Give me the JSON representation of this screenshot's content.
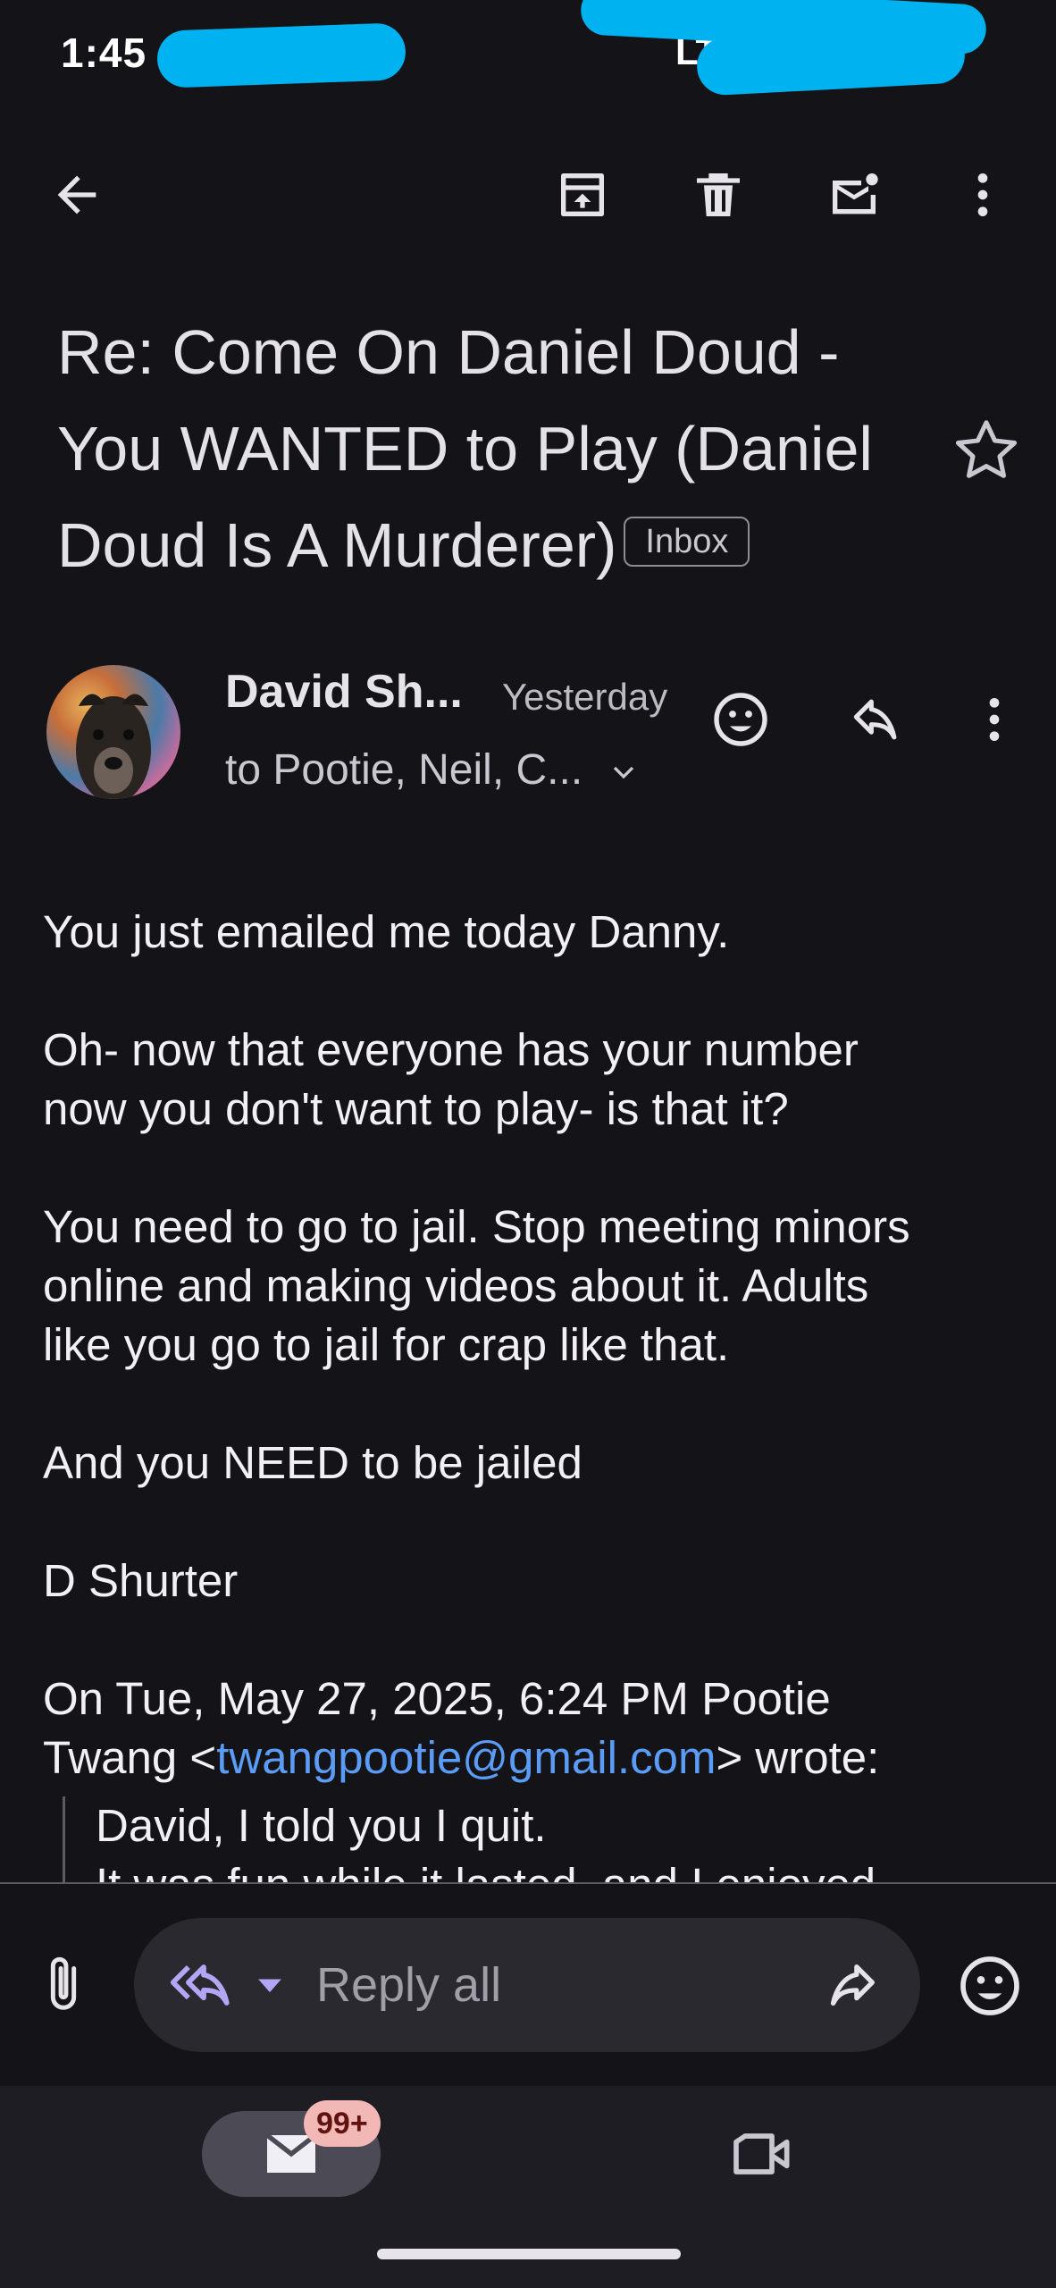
{
  "status_bar": {
    "time": "1:45"
  },
  "toolbar": {
    "back": "back-arrow-icon",
    "archive": "archive-icon",
    "delete": "trash-icon",
    "mark_unread": "mark-unread-icon",
    "more": "more-vert-icon"
  },
  "email": {
    "subject": "Re: Come On Daniel Doud - You WANTED to Play (Daniel Doud Is A Murderer)",
    "label": "Inbox",
    "sender_name": "David Sh...",
    "time": "Yesterday",
    "recipients": "to Pootie, Neil, C...",
    "body_paragraphs": [
      "You just emailed me today Danny.",
      "Oh- now that everyone has your number\nnow you don't want to play- is that it?",
      "You need to go to jail. Stop meeting minors\nonline and making videos about it. Adults\nlike you go to jail for crap like that.",
      "And you NEED to be jailed",
      "D Shurter"
    ],
    "quote_header_prefix": "On Tue, May 27, 2025, 6:24 PM Pootie\nTwang <",
    "quote_header_email": "twangpootie@gmail.com",
    "quote_header_suffix": "> wrote:",
    "quote_lines": [
      "David, I told you I quit.",
      "It was fun while it lasted, and I enjoyed"
    ]
  },
  "reply_bar": {
    "placeholder": "Reply all"
  },
  "bottom_nav": {
    "mail_badge": "99+"
  },
  "colors": {
    "background": "#131318",
    "link": "#5a9cf6",
    "redaction": "#00b2f0",
    "badge": "#f2b8b5"
  }
}
